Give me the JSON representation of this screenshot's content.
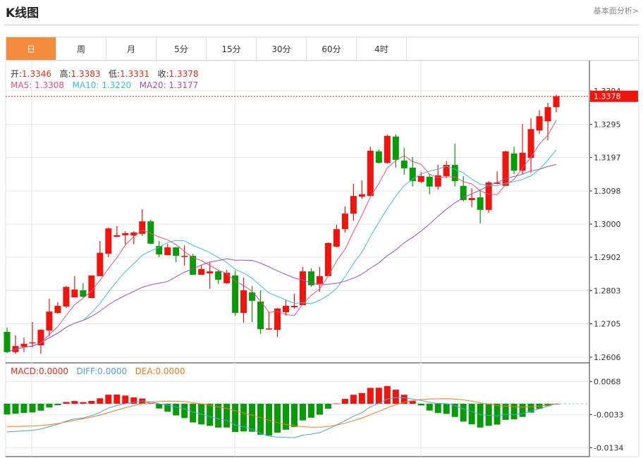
{
  "header": {
    "title": "K线图",
    "link": "基本面分析>"
  },
  "tabs": [
    {
      "label": "日",
      "active": true
    },
    {
      "label": "周"
    },
    {
      "label": "月"
    },
    {
      "label": "5分"
    },
    {
      "label": "15分"
    },
    {
      "label": "30分"
    },
    {
      "label": "60分"
    },
    {
      "label": "4时"
    }
  ],
  "ohlc_info": {
    "open_label": "开:",
    "open": "1.3346",
    "high_label": "高:",
    "high": "1.3383",
    "low_label": "低:",
    "low": "1.3331",
    "close_label": "收:",
    "close": "1.3378"
  },
  "ma_info": {
    "ma5": "MA5: 1.3308",
    "ma10": "MA10: 1.3220",
    "ma20": "MA20: 1.3177"
  },
  "macd_info": {
    "macd": "MACD:0.0000",
    "diff": "DIFF:0.0000",
    "dea": "DEA:0.0000"
  },
  "colors": {
    "up": "#f0140c",
    "down": "#079b07",
    "ma5": "#e8527a",
    "ma10": "#3cc0d2",
    "ma20": "#a050c0",
    "diff": "#4ea0e0",
    "dea": "#f07b1c",
    "tab_active": "#f28b3c"
  },
  "chart_data": [
    {
      "type": "candlestick",
      "price_ticks": [
        "1.3394",
        "1.3295",
        "1.3197",
        "1.3098",
        "1.3000",
        "1.2902",
        "1.2803",
        "1.2705",
        "1.2606"
      ],
      "ylim": [
        1.258,
        1.343
      ],
      "current_price": "1.3378",
      "grid": true,
      "ma_periods": [
        5,
        10,
        20
      ],
      "ohlc": [
        [
          1.2681,
          1.2694,
          1.2618,
          1.2621
        ],
        [
          1.2621,
          1.2671,
          1.2616,
          1.2639
        ],
        [
          1.2637,
          1.2664,
          1.2621,
          1.2646
        ],
        [
          1.2648,
          1.271,
          1.2635,
          1.265
        ],
        [
          1.2641,
          1.2689,
          1.2616,
          1.2687
        ],
        [
          1.2685,
          1.2779,
          1.2668,
          1.2741
        ],
        [
          1.2737,
          1.2769,
          1.2735,
          1.2758
        ],
        [
          1.2756,
          1.2817,
          1.2752,
          1.2814
        ],
        [
          1.2783,
          1.2846,
          1.2783,
          1.2806
        ],
        [
          1.2804,
          1.2825,
          1.2781,
          1.2785
        ],
        [
          1.2781,
          1.2848,
          1.2781,
          1.2848
        ],
        [
          1.2846,
          1.295,
          1.2846,
          1.2915
        ],
        [
          1.2912,
          1.299,
          1.2902,
          1.2987
        ],
        [
          1.2962,
          1.2994,
          1.2962,
          1.2967
        ],
        [
          1.2967,
          1.2979,
          1.294,
          1.2973
        ],
        [
          1.2966,
          1.2979,
          1.294,
          1.2975
        ],
        [
          1.2971,
          1.3044,
          1.2965,
          1.3008
        ],
        [
          1.3008,
          1.3013,
          1.294,
          1.2942
        ],
        [
          1.2935,
          1.295,
          1.2902,
          1.291
        ],
        [
          1.2908,
          1.2942,
          1.2908,
          1.2931
        ],
        [
          1.2931,
          1.2931,
          1.2887,
          1.2906
        ],
        [
          1.2904,
          1.2937,
          1.2877,
          1.2906
        ],
        [
          1.2906,
          1.2912,
          1.285,
          1.285
        ],
        [
          1.285,
          1.2879,
          1.285,
          1.2867
        ],
        [
          1.2854,
          1.2887,
          1.2808,
          1.286
        ],
        [
          1.286,
          1.2864,
          1.2823,
          1.2835
        ],
        [
          1.2825,
          1.2864,
          1.2823,
          1.2856
        ],
        [
          1.2848,
          1.2862,
          1.2729,
          1.2737
        ],
        [
          1.2737,
          1.2842,
          1.2708,
          1.2804
        ],
        [
          1.2798,
          1.2817,
          1.271,
          1.2773
        ],
        [
          1.2771,
          1.2804,
          1.2675,
          1.2689
        ],
        [
          1.2689,
          1.2739,
          1.2687,
          1.2691
        ],
        [
          1.2687,
          1.2752,
          1.2666,
          1.275
        ],
        [
          1.2739,
          1.2775,
          1.2729,
          1.2758
        ],
        [
          1.2754,
          1.2794,
          1.275,
          1.2758
        ],
        [
          1.276,
          1.2873,
          1.276,
          1.286
        ],
        [
          1.286,
          1.2869,
          1.2814,
          1.2819
        ],
        [
          1.2823,
          1.2873,
          1.28,
          1.2846
        ],
        [
          1.2846,
          1.2946,
          1.2846,
          1.2944
        ],
        [
          1.2933,
          1.2998,
          1.2931,
          1.2985
        ],
        [
          1.2985,
          1.3052,
          1.2975,
          1.3031
        ],
        [
          1.3031,
          1.3119,
          1.301,
          1.3083
        ],
        [
          1.3081,
          1.3129,
          1.3075,
          1.3088
        ],
        [
          1.3083,
          1.3229,
          1.3083,
          1.3217
        ],
        [
          1.3215,
          1.3221,
          1.3179,
          1.3181
        ],
        [
          1.3181,
          1.3265,
          1.3179,
          1.3261
        ],
        [
          1.3259,
          1.3265,
          1.3167,
          1.319
        ],
        [
          1.3188,
          1.3225,
          1.3146,
          1.3165
        ],
        [
          1.3167,
          1.3198,
          1.3111,
          1.3127
        ],
        [
          1.3125,
          1.3154,
          1.3121,
          1.3142
        ],
        [
          1.314,
          1.3148,
          1.3088,
          1.3111
        ],
        [
          1.3111,
          1.3175,
          1.3102,
          1.3144
        ],
        [
          1.3142,
          1.3186,
          1.3136,
          1.3175
        ],
        [
          1.3175,
          1.3238,
          1.3111,
          1.3127
        ],
        [
          1.3113,
          1.3142,
          1.3067,
          1.3071
        ],
        [
          1.3071,
          1.3106,
          1.305,
          1.3077
        ],
        [
          1.3079,
          1.31,
          1.3002,
          1.3042
        ],
        [
          1.3042,
          1.3127,
          1.3033,
          1.3123
        ],
        [
          1.3119,
          1.3156,
          1.3117,
          1.3123
        ],
        [
          1.3113,
          1.3217,
          1.3113,
          1.3215
        ],
        [
          1.3209,
          1.3229,
          1.3148,
          1.3158
        ],
        [
          1.3158,
          1.3296,
          1.3148,
          1.3211
        ],
        [
          1.3196,
          1.3313,
          1.3152,
          1.3281
        ],
        [
          1.3277,
          1.3338,
          1.3267,
          1.3319
        ],
        [
          1.3304,
          1.3359,
          1.3248,
          1.3346
        ],
        [
          1.3346,
          1.3383,
          1.3331,
          1.3378
        ]
      ]
    },
    {
      "type": "macd",
      "ticks": [
        "0.0068",
        "-0.0033",
        "-0.0134"
      ],
      "ylim": [
        -0.0145,
        0.011
      ]
    }
  ]
}
